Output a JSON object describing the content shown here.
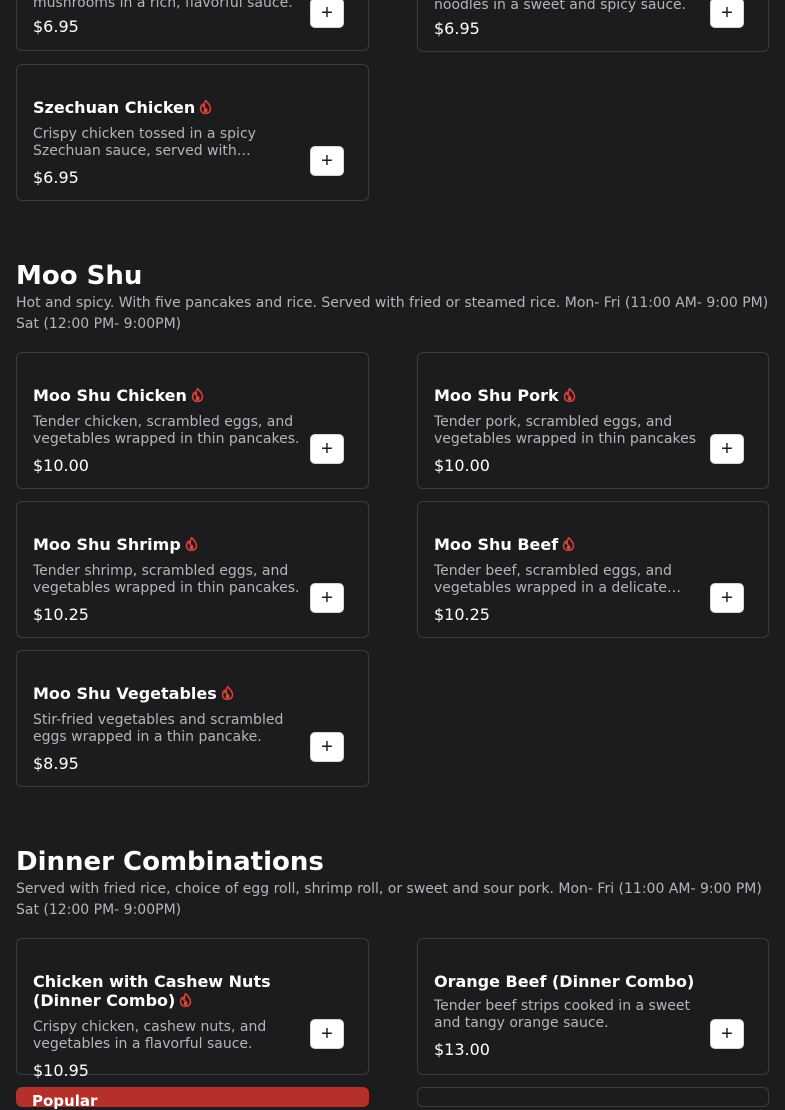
{
  "items": {
    "top_left": {
      "desc": "mushrooms in a rich, flavorful sauce.",
      "price": "$6.95"
    },
    "top_right": {
      "desc": "noodles in a sweet and spicy sauce.",
      "price": "$6.95"
    },
    "szechuan_chicken": {
      "name": "Szechuan Chicken",
      "desc": "Crispy chicken tossed in a spicy Szechuan sauce, served with vegetables.",
      "price": "$6.95"
    },
    "moo_shu_chicken": {
      "name": "Moo Shu Chicken",
      "desc": "Tender chicken, scrambled eggs, and vegetables wrapped in thin pancakes.",
      "price": "$10.00"
    },
    "moo_shu_pork": {
      "name": "Moo Shu Pork",
      "desc": "Tender pork, scrambled eggs, and vegetables wrapped in thin pancakes",
      "price": "$10.00"
    },
    "moo_shu_shrimp": {
      "name": "Moo Shu Shrimp",
      "desc": "Tender shrimp, scrambled eggs, and vegetables wrapped in thin pancakes.",
      "price": "$10.25"
    },
    "moo_shu_beef": {
      "name": "Moo Shu Beef",
      "desc": "Tender beef, scrambled eggs, and vegetables wrapped in a delicate pancake.",
      "price": "$10.25"
    },
    "moo_shu_vegetables": {
      "name": "Moo Shu Vegetables",
      "desc": "Stir-fried vegetables and scrambled eggs wrapped in a thin pancake.",
      "price": "$8.95"
    },
    "cashew_chicken": {
      "name": "Chicken with Cashew Nuts (Dinner Combo)",
      "desc": "Crispy chicken, cashew nuts, and vegetables in a flavorful sauce.",
      "price": "$10.95"
    },
    "orange_beef": {
      "name": "Orange Beef (Dinner Combo)",
      "desc": "Tender beef strips cooked in a sweet and tangy orange sauce.",
      "price": "$13.00"
    }
  },
  "sections": {
    "moo_shu": {
      "title": "Moo Shu",
      "desc": "Hot and spicy. With five pancakes and rice. Served with fried or steamed rice. Mon- Fri (11:00 AM- 9:00 PM) Sat (12:00 PM- 9:00PM)"
    },
    "dinner": {
      "title": "Dinner Combinations",
      "desc": "Served with fried rice, choice of egg roll, shrimp roll, or sweet and sour pork. Mon- Fri (11:00 AM- 9:00 PM) Sat (12:00 PM- 9:00PM)"
    }
  },
  "add_label": "+",
  "badge": {
    "label": "Popular"
  },
  "colors": {
    "spice": "#e0443b",
    "badge": "#b5302a",
    "background": "#1c1b1d"
  }
}
